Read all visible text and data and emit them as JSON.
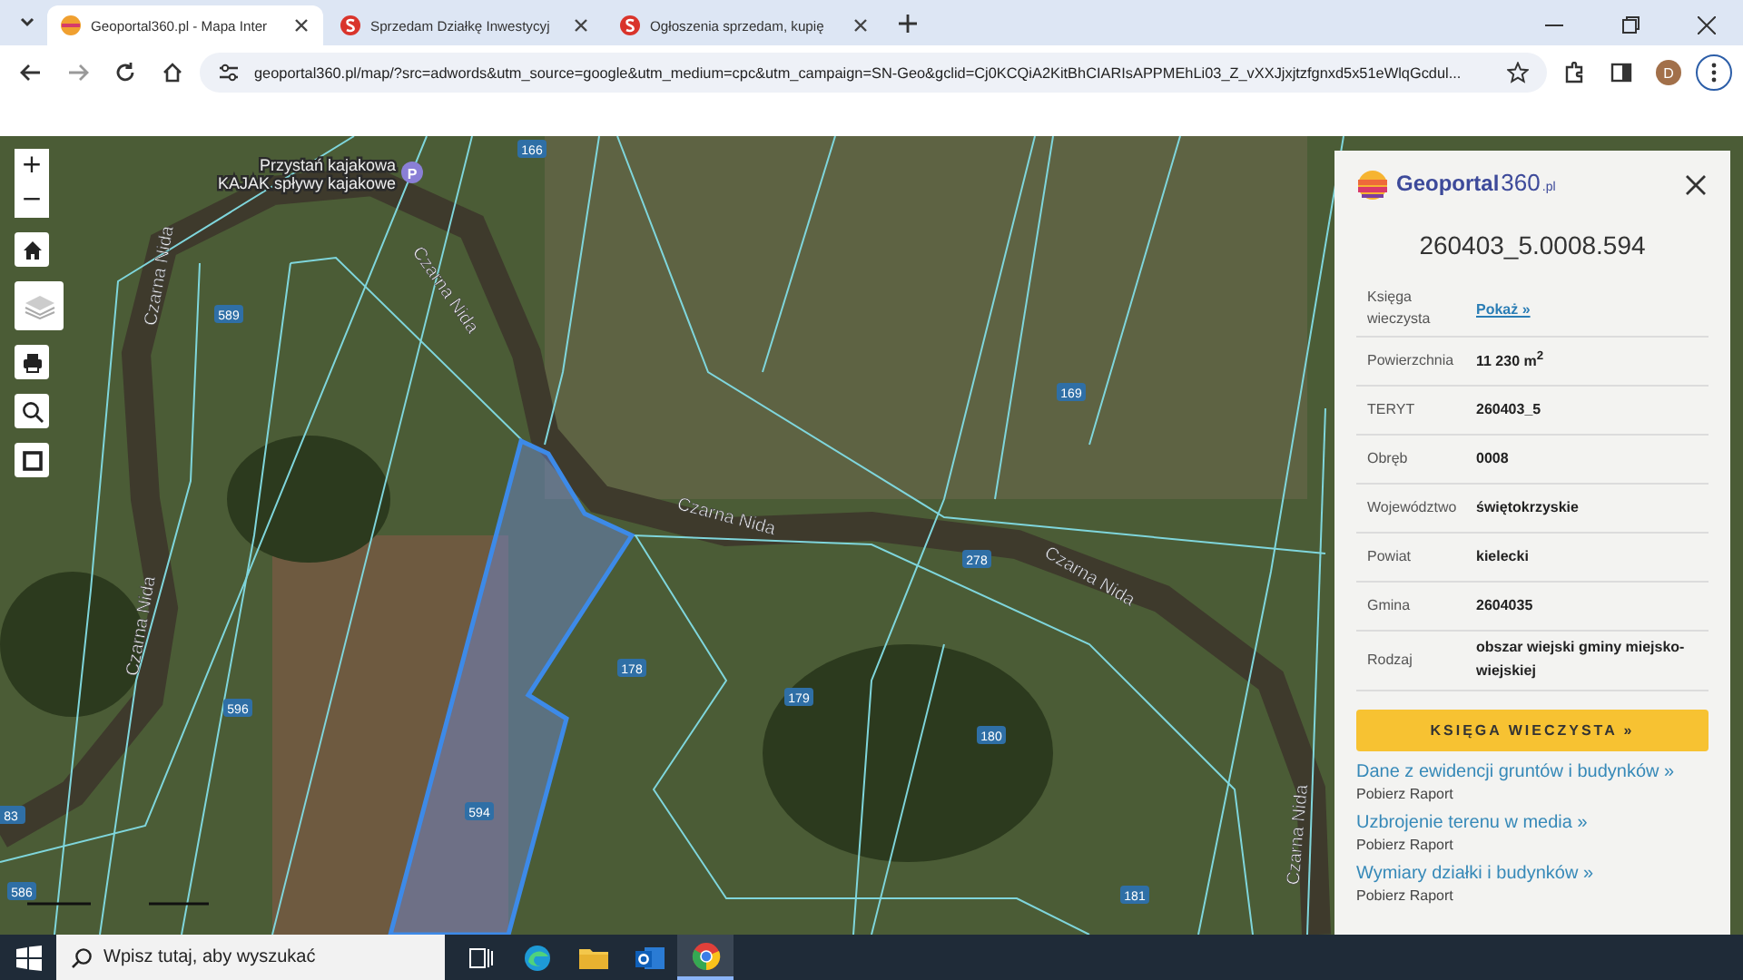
{
  "browser": {
    "tabs": [
      {
        "kind": "geoportal",
        "title": "Geoportal360.pl - Mapa Inter",
        "selected": true
      },
      {
        "kind": "s-logo",
        "title": "Sprzedam Działkę Inwestycyj",
        "selected": false
      },
      {
        "kind": "s-logo",
        "title": "Ogłoszenia sprzedam, kupię",
        "selected": false
      }
    ],
    "url": "geoportal360.pl/map/?src=adwords&utm_source=google&utm_medium=cpc&utm_campaign=SN-Geo&gclid=Cj0KCQiA2KitBhCIARIsAPPMEhLi03_Z_vXXJjxjtzfgnxd5x51eWlqGcdul...",
    "avatar_letter": "D"
  },
  "map": {
    "rivers": [
      "Czarna Nida",
      "Czarna Nida",
      "Czarna Nida",
      "Czarna Nida",
      "Czarna Nida",
      "Czarna Nida"
    ],
    "parcels": [
      "166",
      "589",
      "169",
      "278",
      "178",
      "179",
      "180",
      "596",
      "594",
      "181",
      "83",
      "586"
    ],
    "poi": {
      "name": "Przystań kajakowa",
      "subtitle": "KAJAK spływy kajakowe",
      "badge": "P"
    },
    "controls": [
      "+",
      "−"
    ]
  },
  "panel": {
    "logo": {
      "name": "Geoportal",
      "suffix": "360",
      "tld": ".pl"
    },
    "parcel_id": "260403_5.0008.594",
    "rows": [
      {
        "kind": "link",
        "label": "Księga wieczysta",
        "value": "Pokaż »"
      },
      {
        "kind": "text",
        "label": "Powierzchnia",
        "value": "11 230 m$^{2}$"
      },
      {
        "kind": "text",
        "label": "TERYT",
        "value": "260403_5"
      },
      {
        "kind": "text",
        "label": "Obręb",
        "value": "0008"
      },
      {
        "kind": "text",
        "label": "Województwo",
        "value": "świętokrzyskie"
      },
      {
        "kind": "text",
        "label": "Powiat",
        "value": "kielecki"
      },
      {
        "kind": "text",
        "label": "Gmina",
        "value": "2604035"
      },
      {
        "kind": "text",
        "label": "Rodzaj",
        "value": "obszar wiejski gminy miejsko-wiejskiej"
      }
    ],
    "button": "KSIĘGA WIECZYSTA »",
    "reports": [
      {
        "title": "Dane z ewidencji gruntów i budynków »",
        "sub": "Pobierz Raport"
      },
      {
        "title": "Uzbrojenie terenu w media »",
        "sub": "Pobierz Raport"
      },
      {
        "title": "Wymiary działki i budynków »",
        "sub": "Pobierz Raport"
      }
    ]
  },
  "taskbar": {
    "search_placeholder": "Wpisz tutaj, aby wyszukać"
  }
}
